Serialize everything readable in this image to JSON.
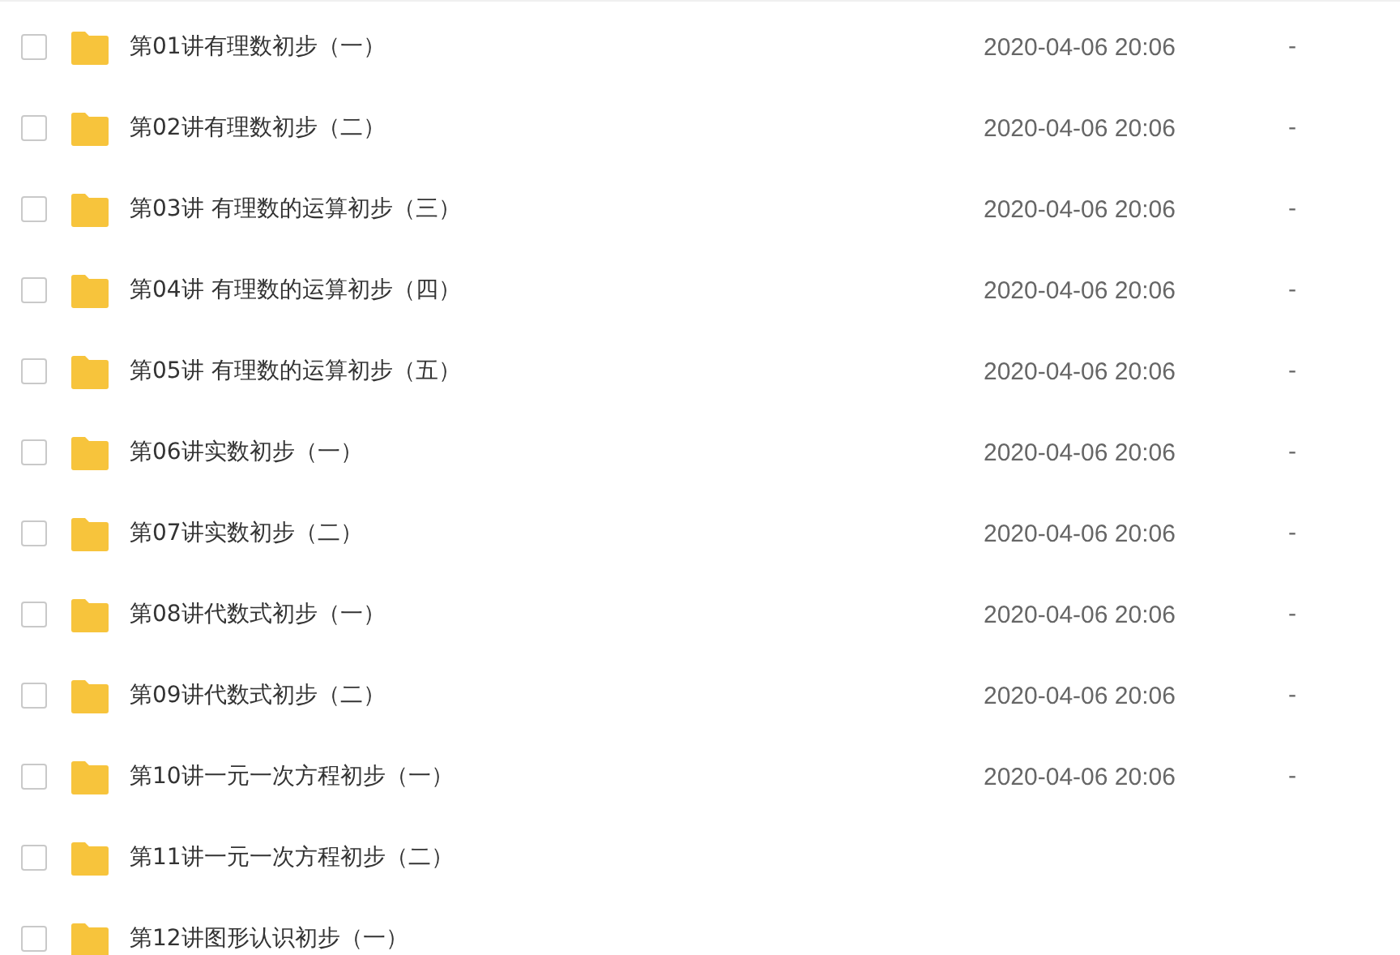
{
  "files": [
    {
      "name": "第01讲有理数初步（一）",
      "checked": false,
      "modified": "2020-04-06 20:06",
      "size": "-"
    },
    {
      "name": "第02讲有理数初步（二）",
      "checked": false,
      "modified": "2020-04-06 20:06",
      "size": "-"
    },
    {
      "name": "第03讲 有理数的运算初步（三）",
      "checked": false,
      "modified": "2020-04-06 20:06",
      "size": "-"
    },
    {
      "name": "第04讲 有理数的运算初步（四）",
      "checked": false,
      "modified": "2020-04-06 20:06",
      "size": "-"
    },
    {
      "name": "第05讲 有理数的运算初步（五）",
      "checked": false,
      "modified": "2020-04-06 20:06",
      "size": "-"
    },
    {
      "name": "第06讲实数初步（一）",
      "checked": false,
      "modified": "2020-04-06 20:06",
      "size": "-"
    },
    {
      "name": "第07讲实数初步（二）",
      "checked": false,
      "modified": "2020-04-06 20:06",
      "size": "-"
    },
    {
      "name": "第08讲代数式初步（一）",
      "checked": false,
      "modified": "2020-04-06 20:06",
      "size": "-"
    },
    {
      "name": "第09讲代数式初步（二）",
      "checked": false,
      "modified": "2020-04-06 20:06",
      "size": "-"
    },
    {
      "name": "第10讲一元一次方程初步（一）",
      "checked": false,
      "modified": "2020-04-06 20:06",
      "size": "-"
    },
    {
      "name": "第11讲一元一次方程初步（二）",
      "checked": false
    },
    {
      "name": "第12讲图形认识初步（一）",
      "checked": false
    }
  ]
}
